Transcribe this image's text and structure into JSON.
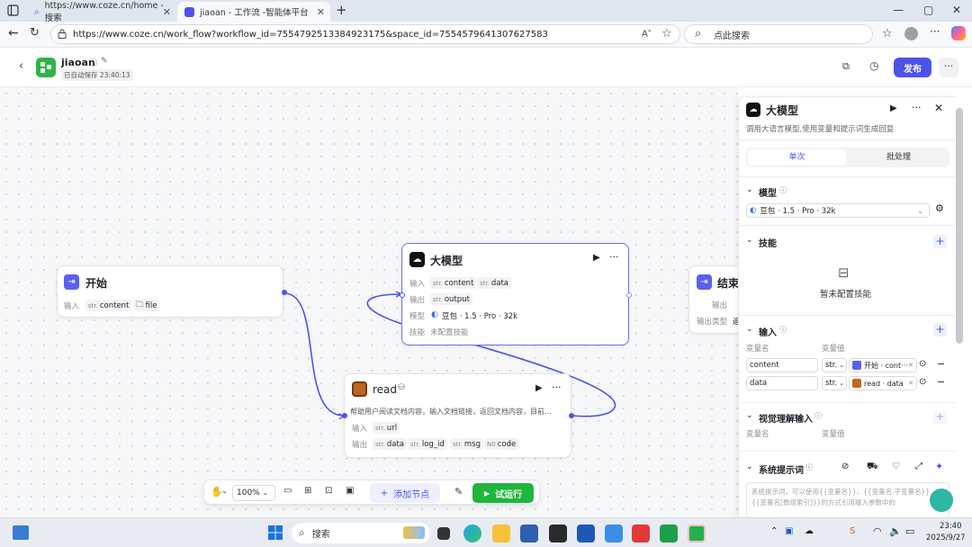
{
  "browser": {
    "tabs": [
      {
        "title": "https://www.coze.cn/home - 搜索"
      },
      {
        "title": "jiaoan - 工作流 -智能体平台"
      }
    ],
    "new_tab": "+",
    "url": "https://www.coze.cn/work_flow?workflow_id=7554792513384923175&space_id=7554579641307627583",
    "search_placeholder": "点此搜索"
  },
  "header": {
    "app_name": "jiaoan",
    "autosave": "已自动保存 23:40:13",
    "publish": "发布"
  },
  "nodes": {
    "start": {
      "title": "开始",
      "input_label": "输入",
      "inputs": [
        {
          "type": "str.",
          "name": "content"
        },
        {
          "type": "",
          "name": "file"
        }
      ]
    },
    "llm": {
      "title": "大模型",
      "input_label": "输入",
      "inputs": [
        {
          "type": "str.",
          "name": "content"
        },
        {
          "type": "str.",
          "name": "data"
        }
      ],
      "output_label": "输出",
      "outputs": [
        {
          "type": "str.",
          "name": "output"
        }
      ],
      "model_label": "模型",
      "model_value": "豆包 · 1.5 · Pro · 32k",
      "skill_label": "技能",
      "skill_value": "未配置技能"
    },
    "end": {
      "title": "结束",
      "output_label": "输出",
      "output_type_label": "输出类型",
      "output_type_value": "返"
    },
    "read": {
      "title": "read",
      "desc": "帮助用户阅读文档内容，输入文档链接，返回文档内容，目前…",
      "input_label": "输入",
      "inputs": [
        {
          "type": "str.",
          "name": "url"
        }
      ],
      "output_label": "输出",
      "outputs": [
        {
          "type": "str.",
          "name": "data"
        },
        {
          "type": "str.",
          "name": "log_id"
        },
        {
          "type": "str.",
          "name": "msg"
        },
        {
          "type": "N0",
          "name": "code"
        }
      ]
    }
  },
  "toolbar": {
    "zoom": "100%",
    "add_node": "添加节点",
    "run": "试运行"
  },
  "panel": {
    "title": "大模型",
    "desc": "调用大语言模型,使用变量和提示词生成回复",
    "tabs": [
      "单次",
      "批处理"
    ],
    "model_section": "模型",
    "model_value": "豆包 · 1.5 · Pro · 32k",
    "skill_section": "技能",
    "skill_empty": "暂未配置技能",
    "input_section": "输入",
    "var_name_header": "变量名",
    "var_value_header": "变量值",
    "vars": [
      {
        "name": "content",
        "type": "str.",
        "ref": "开始 · cont···"
      },
      {
        "name": "data",
        "type": "str.",
        "ref": "read · data"
      }
    ],
    "vision_section": "视觉理解输入",
    "vision_name_header": "变量名",
    "vision_value_header": "变量值",
    "prompt_section": "系统提示词",
    "prompt_placeholder": "系统提示词，可以使用{{变量名}}、{{变量名.子变量名}}、{{变量名[数组索引]}}的方式引用输入参数中的"
  },
  "taskbar": {
    "search": "搜索",
    "time": "23:40",
    "date": "2025/9/27"
  },
  "colors": {
    "accent": "#4d53e8",
    "run": "#1fb63d"
  }
}
